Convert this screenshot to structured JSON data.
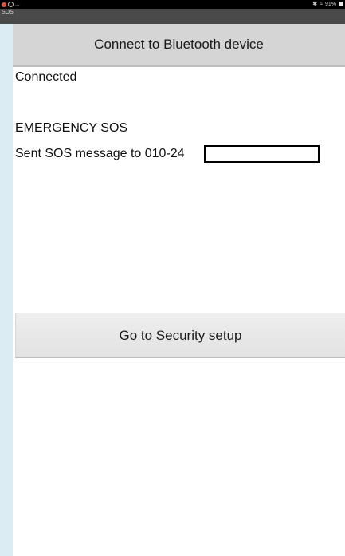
{
  "statusbar": {
    "left_text": "...",
    "right_text": "91%",
    "icons": [
      "notification-icon",
      "status-icon",
      "bluetooth-icon",
      "wifi-icon",
      "battery-icon"
    ]
  },
  "appbar": {
    "title": "SOS"
  },
  "main": {
    "connect_button_label": "Connect to Bluetooth device",
    "connection_status": "Connected",
    "emergency_heading": "EMERGENCY SOS",
    "sent_message": "Sent SOS message to 010-24",
    "security_button_label": "Go to Security setup"
  },
  "colors": {
    "side_strip": "#dcecf3",
    "connect_button": "#d5d5d5",
    "security_button": "#e6e6e6"
  }
}
